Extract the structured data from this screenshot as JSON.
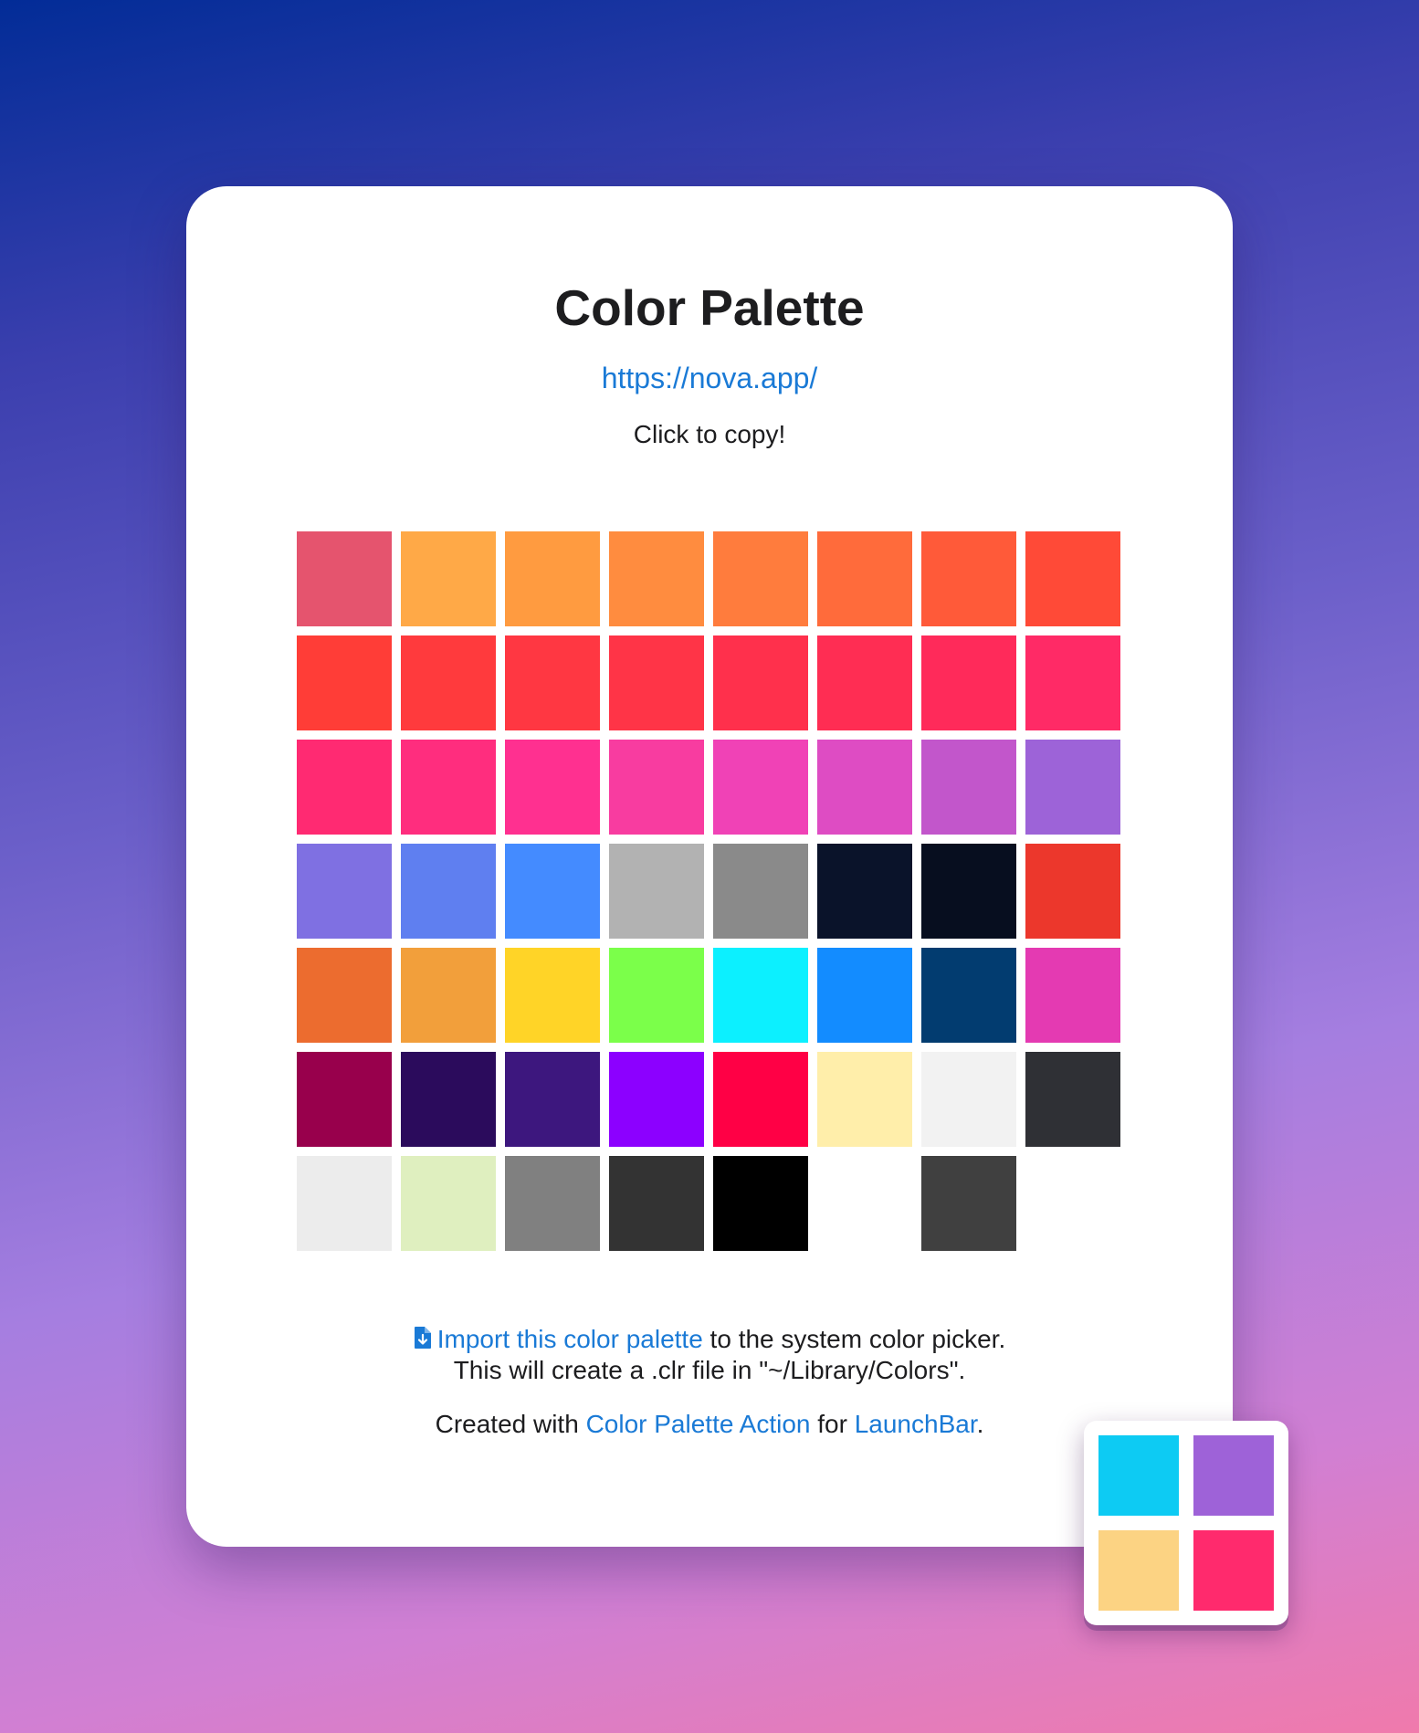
{
  "header": {
    "title": "Color Palette",
    "url": "https://nova.app/",
    "hint": "Click to copy!"
  },
  "palette": {
    "swatches": [
      "#e5546e",
      "#ffa947",
      "#ff9b40",
      "#ff8c3f",
      "#ff7c3d",
      "#ff6b3b",
      "#ff5a39",
      "#ff4a37",
      "#ff3d37",
      "#ff3a3d",
      "#ff3742",
      "#ff3447",
      "#ff304c",
      "#ff2d53",
      "#ff2a5a",
      "#ff2a66",
      "#ff2a72",
      "#ff2d7e",
      "#ff3090",
      "#f83ca0",
      "#f042b6",
      "#de4cc3",
      "#c256cb",
      "#9d63d8",
      "#7f70e2",
      "#5f7ff0",
      "#448bff",
      "#b2b2b2",
      "#8a8a8a",
      "#0a132a",
      "#070e1f",
      "#ec372c",
      "#ec6c2f",
      "#f29f3b",
      "#ffd427",
      "#7bff4a",
      "#0cf0ff",
      "#138cff",
      "#023c70",
      "#e43ab2",
      "#98004c",
      "#2b0b5c",
      "#3d177e",
      "#8c00ff",
      "#ff0045",
      "#ffeeaa",
      "#f2f2f2",
      "#2f3035",
      "#ececec",
      "#dfefbf",
      "#808080",
      "#333333",
      "#000000",
      "#ffffff",
      "#404040"
    ]
  },
  "footer": {
    "import_link": "Import this color palette",
    "import_rest": " to the system color picker.",
    "import_note": "This will create a .clr file in \"~/Library/Colors\".",
    "credit_prefix": "Created with ",
    "credit_link1": "Color Palette Action",
    "credit_mid": " for ",
    "credit_link2": "LaunchBar",
    "credit_suffix": "."
  },
  "app_icon": {
    "colors": [
      "#0dcbf3",
      "#9e62d8",
      "#fcd383",
      "#ff2a6d"
    ]
  },
  "colors": {
    "link": "#1a7ad6",
    "text": "#1d1d1f"
  }
}
